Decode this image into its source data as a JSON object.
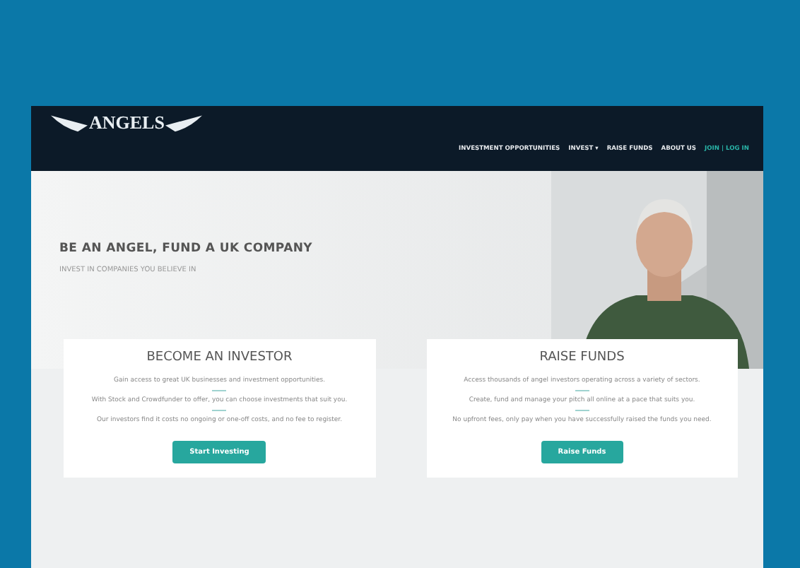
{
  "header": {
    "logo": "ANGELS",
    "nav": [
      {
        "label": "INVESTMENT OPPORTUNITIES",
        "kind": "link"
      },
      {
        "label": "INVEST ▾",
        "kind": "link"
      },
      {
        "label": "RAISE FUNDS",
        "kind": "link"
      },
      {
        "label": "ABOUT US",
        "kind": "link"
      },
      {
        "label": "JOIN | LOG IN",
        "kind": "account"
      }
    ]
  },
  "hero": {
    "title": "BE AN ANGEL, FUND A UK COMPANY",
    "subtitle": "INVEST IN COMPANIES YOU BELIEVE IN"
  },
  "cards": [
    {
      "title": "BECOME AN INVESTOR",
      "points": [
        "Gain access to great UK businesses and investment opportunities.",
        "With Stock and Crowdfunder to offer, you can choose investments that suit you.",
        "Our investors find it costs no ongoing or one-off costs, and no fee to register."
      ],
      "button": "Start Investing"
    },
    {
      "title": "RAISE FUNDS",
      "points": [
        "Access thousands of angel investors operating across a variety of sectors.",
        "Create, fund and manage your pitch all online at a pace that suits you.",
        "No upfront fees, only pay when you have successfully raised the funds you need."
      ],
      "button": "Raise Funds"
    }
  ]
}
